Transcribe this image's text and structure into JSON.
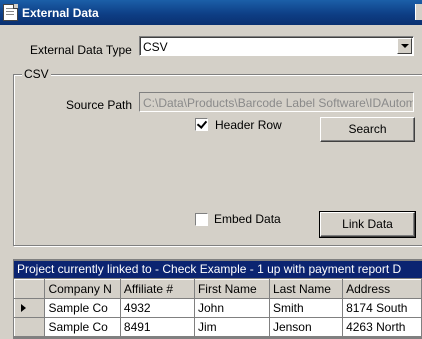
{
  "window": {
    "title": "External Data"
  },
  "data_type": {
    "label": "External Data Type",
    "value": "CSV"
  },
  "csv_group": {
    "legend": "CSV",
    "source_path_label": "Source Path",
    "source_path_value": "C:\\Data\\Products\\Barcode Label Software\\IDAutom",
    "header_row_label": "Header Row",
    "header_row_checked": true,
    "search_label": "Search",
    "embed_data_label": "Embed Data",
    "embed_data_checked": false,
    "link_data_label": "Link Data"
  },
  "linked_banner": "Project currently linked to - Check Example - 1 up with payment report D",
  "grid": {
    "columns": [
      "Company N",
      "Affiliate #",
      "First Name",
      "Last Name",
      "Address"
    ],
    "rows": [
      {
        "current": true,
        "cells": [
          "Sample Co",
          "4932",
          "John",
          "Smith",
          "8174 South"
        ]
      },
      {
        "current": false,
        "cells": [
          "Sample Co",
          "8491",
          "Jim",
          "Jenson",
          "4263 North"
        ]
      }
    ]
  },
  "icons": {
    "app": "document-icon",
    "combo": "chevron-down-icon",
    "row_pointer": "row-pointer-icon"
  }
}
